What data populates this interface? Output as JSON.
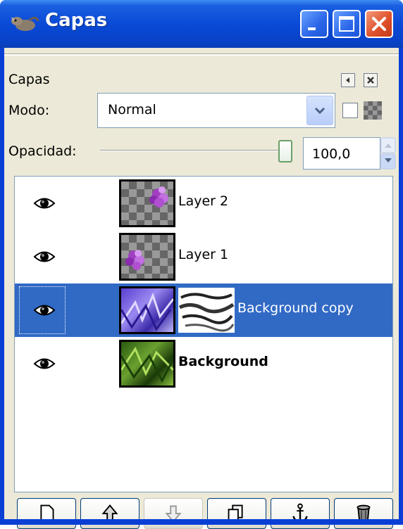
{
  "window": {
    "title": "Capas"
  },
  "panel": {
    "label": "Capas",
    "mode_label": "Modo:",
    "mode_value": "Normal",
    "opacity_label": "Opacidad:",
    "opacity_value": "100,0",
    "opacity_percent": 100
  },
  "layers": [
    {
      "name": "Layer 2",
      "visible": true,
      "selected": false,
      "bold": false
    },
    {
      "name": "Layer 1",
      "visible": true,
      "selected": false,
      "bold": false
    },
    {
      "name": "Background copy",
      "visible": true,
      "selected": true,
      "bold": false,
      "has_mask": true
    },
    {
      "name": "Background",
      "visible": true,
      "selected": false,
      "bold": true
    }
  ],
  "buttons": [
    {
      "icon": "new-layer-icon",
      "enabled": true
    },
    {
      "icon": "raise-layer-icon",
      "enabled": true
    },
    {
      "icon": "lower-layer-icon",
      "enabled": false
    },
    {
      "icon": "duplicate-layer-icon",
      "enabled": true
    },
    {
      "icon": "anchor-layer-icon",
      "enabled": true
    },
    {
      "icon": "delete-layer-icon",
      "enabled": true
    }
  ],
  "colors": {
    "selection": "#316ac5",
    "titlebar": "#0a4ad6",
    "dialog_bg": "#ece9d8"
  }
}
